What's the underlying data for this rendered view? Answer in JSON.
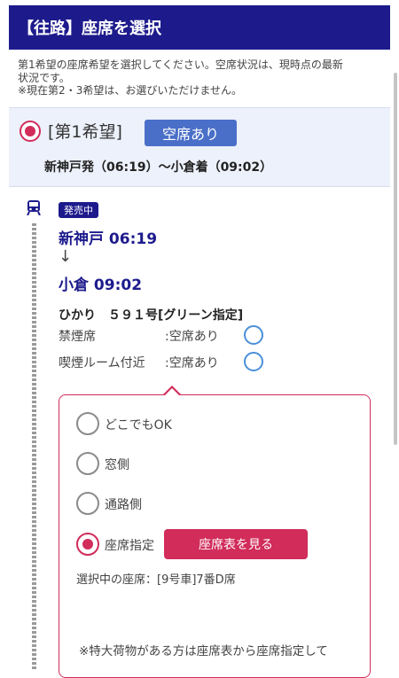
{
  "header": {
    "title": "【往路】座席を選択"
  },
  "intro": {
    "line1": "第1希望の座席希望を選択してください。空席状況は、現時点の最新",
    "line2": "状況です。",
    "line3": "※現在第2・3希望は、お選びいただけません。"
  },
  "choice": {
    "label": "[第1希望]",
    "vacancy": "空席あり",
    "route": "新神戸発（06:19）〜小倉着（09:02）"
  },
  "train": {
    "sale_status": "発売中",
    "departure": "新神戸 06:19",
    "arrow": "↓",
    "arrival": "小倉 09:02",
    "name": "ひかり　５９１号[グリーン指定]",
    "seat_types": [
      {
        "label": "禁煙席",
        "status": ":空席あり"
      },
      {
        "label": "喫煙ルーム付近",
        "status": ":空席あり"
      }
    ]
  },
  "seat_options": [
    {
      "label": "どこでもOK",
      "selected": false
    },
    {
      "label": "窓側",
      "selected": false
    },
    {
      "label": "通路側",
      "selected": false
    },
    {
      "label": "座席指定",
      "selected": true
    }
  ],
  "seatmap_button": "座席表を見る",
  "selected_seat": "選択中の座席：[9号車]7番D席",
  "note": "※特大荷物がある方は座席表から座席指定して",
  "colors": {
    "header_bg": "#1d1b8c",
    "accent_red": "#d12c5a",
    "badge_blue": "#4a6fc8",
    "band_bg": "#edf1fb"
  }
}
